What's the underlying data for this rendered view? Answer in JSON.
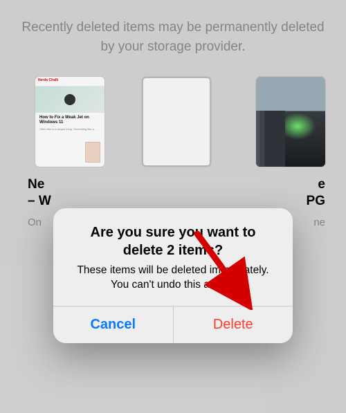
{
  "header": {
    "notice": "Recently deleted items may be permanently deleted by your storage provider."
  },
  "items": [
    {
      "name_visible": "Ne",
      "name_line2": "– W",
      "sub_visible": "On"
    },
    {
      "name_visible": "",
      "name_line2": "",
      "sub_visible": ""
    },
    {
      "name_visible": "e",
      "name_line2": "PG",
      "sub_visible": "ne"
    }
  ],
  "dialog": {
    "title": "Are you sure you want to delete 2 items?",
    "message": "These items will be deleted immediately. You can't undo this action.",
    "cancel_label": "Cancel",
    "delete_label": "Delete"
  },
  "annotation": {
    "arrow_color": "#d40000"
  }
}
